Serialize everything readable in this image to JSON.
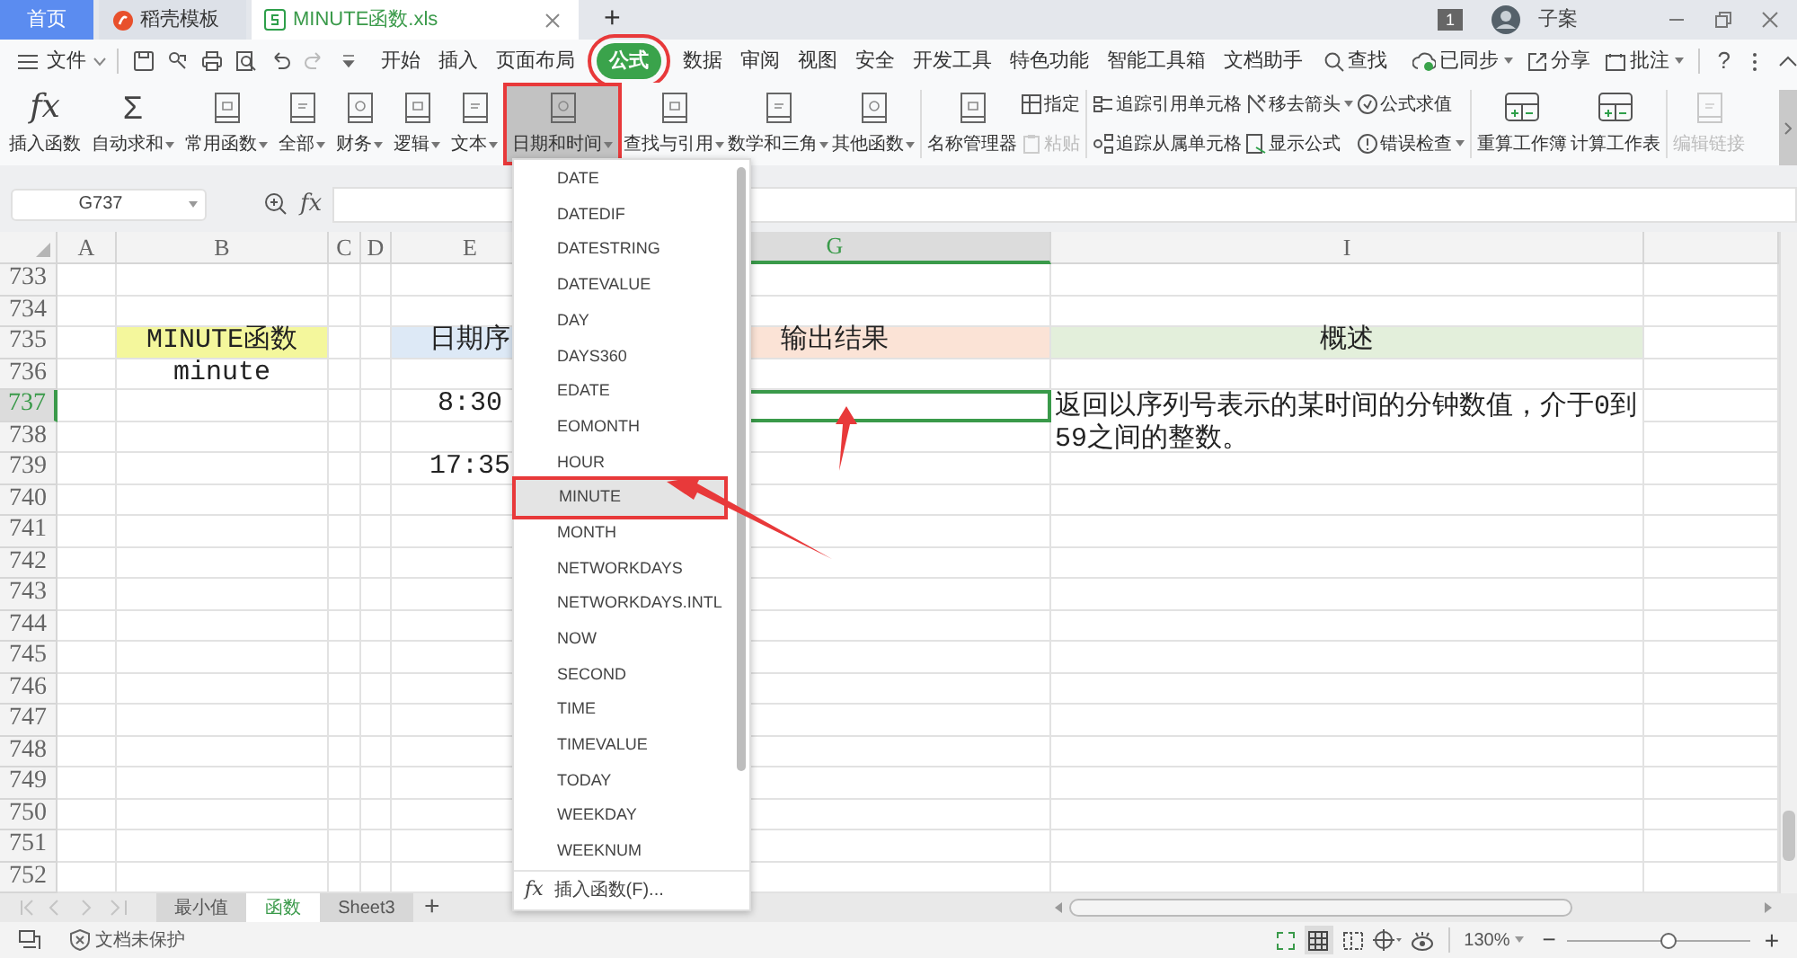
{
  "tabs": [
    {
      "label": "首页",
      "kind": "home",
      "selected": false
    },
    {
      "label": "稻壳模板",
      "kind": "docer",
      "selected": false
    },
    {
      "label": "MINUTE函数.xls",
      "kind": "sheet",
      "selected": true
    }
  ],
  "new_tab": "+",
  "account": {
    "badge": "1",
    "user": "子案"
  },
  "menu": {
    "file": "文件",
    "tabs": [
      {
        "label": "开始",
        "selected": false
      },
      {
        "label": "插入",
        "selected": false
      },
      {
        "label": "页面布局",
        "selected": false
      },
      {
        "label": "公式",
        "selected": true
      },
      {
        "label": "数据",
        "selected": false
      },
      {
        "label": "审阅",
        "selected": false
      },
      {
        "label": "视图",
        "selected": false
      },
      {
        "label": "安全",
        "selected": false
      },
      {
        "label": "开发工具",
        "selected": false
      },
      {
        "label": "特色功能",
        "selected": false
      },
      {
        "label": "智能工具箱",
        "selected": false
      },
      {
        "label": "文档助手",
        "selected": false
      }
    ],
    "search": "查找",
    "sync": "已同步",
    "share": "分享",
    "comment": "批注",
    "help": "?"
  },
  "ribbon": [
    {
      "kind": "fx",
      "icon_text": "fx",
      "label": "插入函数",
      "dropdown": false,
      "pressed": false,
      "disabled": false
    },
    {
      "kind": "sum",
      "icon_text": "Σ",
      "label": "自动求和",
      "dropdown": true,
      "pressed": false,
      "disabled": false
    },
    {
      "kind": "book",
      "label": "常用函数",
      "dropdown": true,
      "pressed": false,
      "disabled": false
    },
    {
      "kind": "book",
      "label": "全部",
      "dropdown": true,
      "pressed": false,
      "disabled": false
    },
    {
      "kind": "book",
      "label": "财务",
      "dropdown": true,
      "pressed": false,
      "disabled": false
    },
    {
      "kind": "book",
      "label": "逻辑",
      "dropdown": true,
      "pressed": false,
      "disabled": false
    },
    {
      "kind": "book",
      "label": "文本",
      "dropdown": true,
      "pressed": false,
      "disabled": false
    },
    {
      "kind": "book",
      "label": "日期和时间",
      "dropdown": true,
      "pressed": true,
      "disabled": false
    },
    {
      "kind": "book",
      "label": "查找与引用",
      "dropdown": true,
      "pressed": false,
      "disabled": false
    },
    {
      "kind": "book",
      "label": "数学和三角",
      "dropdown": true,
      "pressed": false,
      "disabled": false
    },
    {
      "kind": "book",
      "label": "其他函数",
      "dropdown": true,
      "pressed": false,
      "disabled": false
    },
    {
      "kind": "divider"
    },
    {
      "kind": "book",
      "label": "名称管理器",
      "dropdown": false,
      "pressed": false,
      "disabled": false
    },
    {
      "kind": "pair",
      "items": [
        {
          "label": "指定",
          "dropdown": false,
          "disabled": false
        },
        {
          "label": "粘贴",
          "dropdown": false,
          "disabled": true
        }
      ]
    },
    {
      "kind": "divider"
    },
    {
      "kind": "pair",
      "items": [
        {
          "label": "追踪引用单元格",
          "dropdown": false,
          "disabled": false
        },
        {
          "label": "追踪从属单元格",
          "dropdown": false,
          "disabled": false
        }
      ]
    },
    {
      "kind": "pair",
      "items": [
        {
          "label": "移去箭头",
          "dropdown": true,
          "disabled": false
        },
        {
          "label": "显示公式",
          "dropdown": false,
          "disabled": false
        }
      ]
    },
    {
      "kind": "pair",
      "items": [
        {
          "label": "公式求值",
          "dropdown": false,
          "disabled": false
        },
        {
          "label": "错误检查",
          "dropdown": true,
          "disabled": false
        }
      ]
    },
    {
      "kind": "divider"
    },
    {
      "kind": "sheet",
      "label": "重算工作簿",
      "dropdown": false,
      "pressed": false,
      "disabled": false
    },
    {
      "kind": "sheet",
      "label": "计算工作表",
      "dropdown": false,
      "pressed": false,
      "disabled": false
    },
    {
      "kind": "divider"
    },
    {
      "kind": "book",
      "label": "编辑链接",
      "dropdown": false,
      "pressed": false,
      "disabled": true
    }
  ],
  "formula_bar": {
    "name_box": "G737",
    "fx": "fx"
  },
  "sheet": {
    "columns": [
      {
        "label": "A",
        "selected": false
      },
      {
        "label": "B",
        "selected": false
      },
      {
        "label": "C",
        "selected": false
      },
      {
        "label": "D",
        "selected": false
      },
      {
        "label": "E",
        "selected": false
      },
      {
        "label": "G",
        "selected": true
      },
      {
        "label": "I",
        "selected": false
      }
    ],
    "rows": [
      {
        "number": "733",
        "selected": false
      },
      {
        "number": "734",
        "selected": false
      },
      {
        "number": "735",
        "selected": false,
        "cells": [
          null,
          {
            "text": "MINUTE函数",
            "color": "#f4f79c",
            "kind": "center"
          },
          null,
          null,
          {
            "text": "日期序",
            "color": "#dde9f6",
            "kind": "center"
          },
          {
            "text": "输出结果",
            "color": "#fbe3d6",
            "kind": "center"
          },
          {
            "text": "概述",
            "color": "#e3efdb",
            "kind": "center"
          }
        ]
      },
      {
        "number": "736",
        "selected": false,
        "cells": [
          null,
          {
            "text": "minute",
            "kind": "center"
          },
          null,
          null,
          null,
          null,
          null
        ]
      },
      {
        "number": "737",
        "selected": true,
        "cells": [
          null,
          null,
          null,
          null,
          {
            "text": "8:30",
            "kind": "center"
          },
          null,
          {
            "text": "返回以序列号表示的某时间的分钟数值，介于0到59之间的整数。",
            "kind": "note"
          }
        ]
      },
      {
        "number": "738",
        "selected": false
      },
      {
        "number": "739",
        "selected": false,
        "cells": [
          null,
          null,
          null,
          null,
          {
            "text": "17:35",
            "kind": "center"
          },
          null,
          null
        ]
      },
      {
        "number": "740",
        "selected": false
      },
      {
        "number": "741",
        "selected": false
      },
      {
        "number": "742",
        "selected": false
      },
      {
        "number": "743",
        "selected": false
      },
      {
        "number": "744",
        "selected": false
      },
      {
        "number": "745",
        "selected": false
      },
      {
        "number": "746",
        "selected": false
      },
      {
        "number": "747",
        "selected": false
      },
      {
        "number": "748",
        "selected": false
      },
      {
        "number": "749",
        "selected": false
      },
      {
        "number": "750",
        "selected": false
      },
      {
        "number": "751",
        "selected": false
      },
      {
        "number": "752",
        "selected": false
      }
    ]
  },
  "dropdown": {
    "items": [
      {
        "label": "DATE",
        "selected": false
      },
      {
        "label": "DATEDIF",
        "selected": false
      },
      {
        "label": "DATESTRING",
        "selected": false
      },
      {
        "label": "DATEVALUE",
        "selected": false
      },
      {
        "label": "DAY",
        "selected": false
      },
      {
        "label": "DAYS360",
        "selected": false
      },
      {
        "label": "EDATE",
        "selected": false
      },
      {
        "label": "EOMONTH",
        "selected": false
      },
      {
        "label": "HOUR",
        "selected": false
      },
      {
        "label": "MINUTE",
        "selected": true
      },
      {
        "label": "MONTH",
        "selected": false
      },
      {
        "label": "NETWORKDAYS",
        "selected": false
      },
      {
        "label": "NETWORKDAYS.INTL",
        "selected": false
      },
      {
        "label": "NOW",
        "selected": false
      },
      {
        "label": "SECOND",
        "selected": false
      },
      {
        "label": "TIME",
        "selected": false
      },
      {
        "label": "TIMEVALUE",
        "selected": false
      },
      {
        "label": "TODAY",
        "selected": false
      },
      {
        "label": "WEEKDAY",
        "selected": false
      },
      {
        "label": "WEEKNUM",
        "selected": false
      }
    ],
    "footer_icon": "fx",
    "footer": "插入函数(F)..."
  },
  "sheet_tabs": [
    {
      "label": "最小值",
      "selected": false
    },
    {
      "label": "函数",
      "selected": true
    },
    {
      "label": "Sheet3",
      "selected": false
    }
  ],
  "add_sheet": "+",
  "status_bar": {
    "protection": "文档未保护",
    "zoom": "130%",
    "zoom_level": {
      "level": 0.55
    },
    "minus": "−",
    "plus": "+"
  }
}
